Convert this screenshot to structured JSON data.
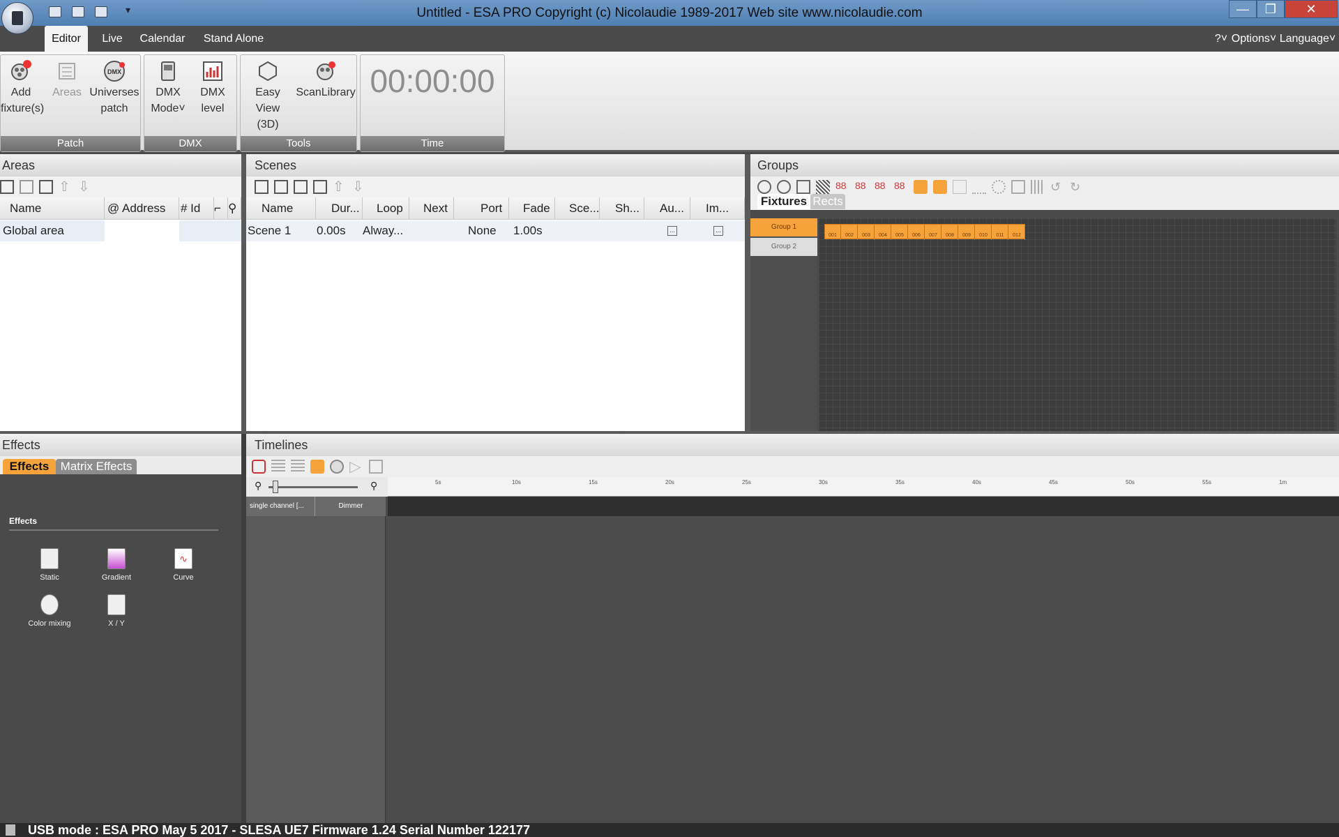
{
  "window": {
    "title": "Untitled - ESA PRO    Copyright (c) Nicolaudie 1989-2017    Web site www.nicolaudie.com",
    "minimize": "—",
    "restore": "❐",
    "close": "✕"
  },
  "menu": {
    "tabs": [
      "Editor",
      "Live",
      "Calendar",
      "Stand Alone"
    ],
    "help": "?˅",
    "options": "Options˅",
    "language": "Language˅"
  },
  "ribbon": {
    "patch": {
      "label": "Patch",
      "add": "Add\nfixture(s)",
      "areas": "Areas",
      "universes": "Universes\npatch"
    },
    "dmx": {
      "label": "DMX",
      "mode": "DMX\nMode˅",
      "level": "DMX\nlevel"
    },
    "tools": {
      "label": "Tools",
      "easyview": "Easy View\n(3D)",
      "scanlibrary": "ScanLibrary"
    },
    "time": {
      "label": "Time",
      "clock": "00:00:00"
    }
  },
  "areas": {
    "title": "Areas",
    "columns": [
      "Name",
      "@ Address",
      "# Id"
    ],
    "rows": [
      {
        "name": "Global area"
      }
    ]
  },
  "scenes": {
    "title": "Scenes",
    "columns": [
      "Name",
      "Dur...",
      "Loop",
      "Next",
      "Port",
      "Fade",
      "Sce...",
      "Sh...",
      "Au...",
      "Im..."
    ],
    "rows": [
      {
        "name": "Scene 1",
        "duration": "0.00s",
        "loop": "Alway...",
        "port": "None",
        "fade": "1.00s"
      }
    ]
  },
  "groups": {
    "title": "Groups",
    "tabs": [
      "Fixtures",
      "Rects"
    ],
    "list": [
      "Group 1",
      "Group 2"
    ],
    "fixtures": [
      "001",
      "002",
      "003",
      "004",
      "005",
      "006",
      "007",
      "008",
      "009",
      "010",
      "011",
      "012"
    ]
  },
  "effects": {
    "title": "Effects",
    "tabs": [
      "Effects",
      "Matrix Effects"
    ],
    "section": "Effects",
    "items": [
      "Static",
      "Gradient",
      "Curve",
      "Color mixing",
      "X / Y"
    ]
  },
  "timelines": {
    "title": "Timelines",
    "ruler": [
      "5s",
      "10s",
      "15s",
      "20s",
      "25s",
      "30s",
      "35s",
      "40s",
      "45s",
      "50s",
      "55s",
      "1m"
    ],
    "tracks": [
      "single channel [...",
      "Dimmer"
    ]
  },
  "status": {
    "text": "USB mode : ESA PRO May  5 2017 - SLESA UE7 Firmware 1.24 Serial Number 122177"
  },
  "colors": {
    "accent": "#f7a33c",
    "titlebar": "#5a88bd",
    "dark": "#4a4a4a"
  }
}
